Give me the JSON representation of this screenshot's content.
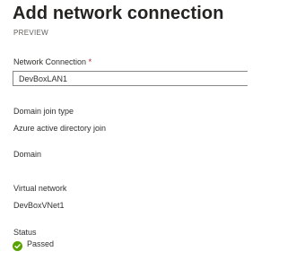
{
  "header": {
    "title": "Add network connection",
    "subtitle": "PREVIEW"
  },
  "network_connection": {
    "label": "Network Connection",
    "required_marker": "*",
    "value": "DevBoxLAN1"
  },
  "domain_join_type": {
    "label": "Domain join type",
    "value": "Azure active directory join"
  },
  "domain": {
    "label": "Domain"
  },
  "virtual_network": {
    "label": "Virtual network",
    "value": "DevBoxVNet1"
  },
  "status": {
    "label": "Status",
    "value": "Passed",
    "icon": "check-circle-icon",
    "color": "#57a300"
  }
}
